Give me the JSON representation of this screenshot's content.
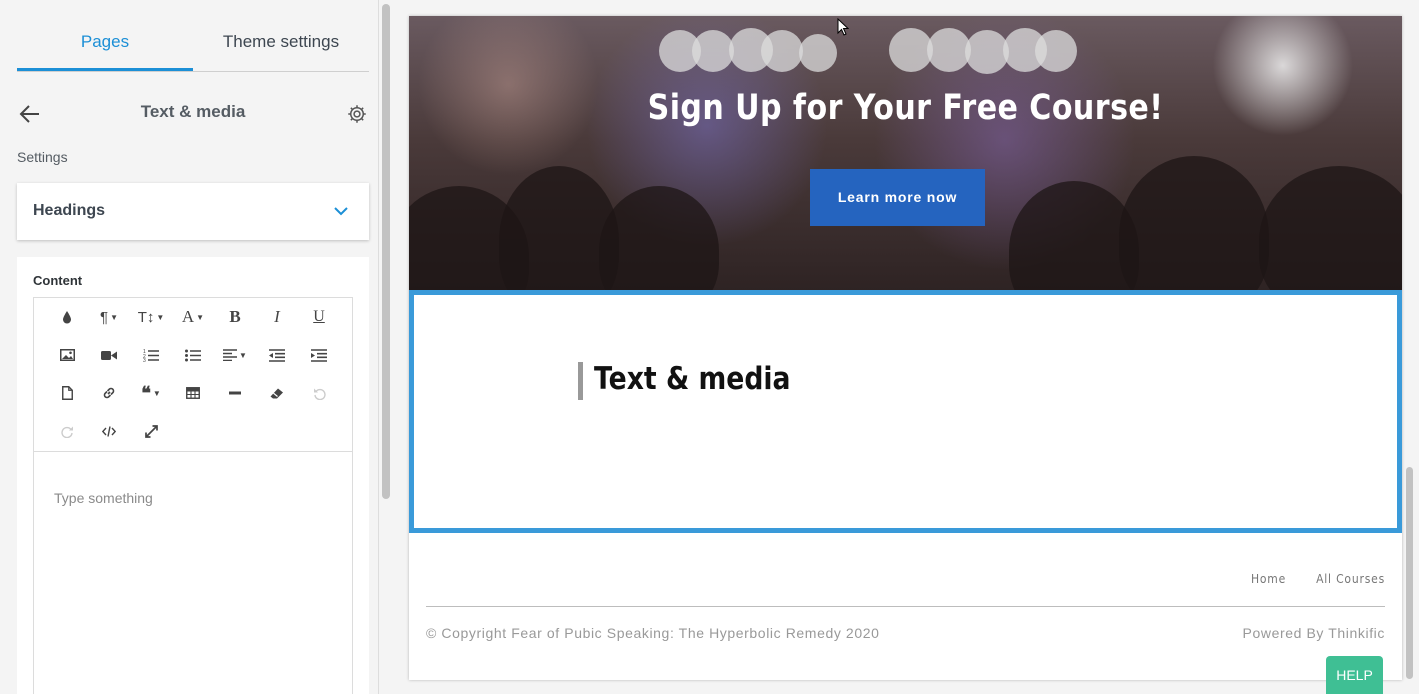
{
  "sidebar": {
    "tabs": [
      {
        "label": "Pages",
        "active": true
      },
      {
        "label": "Theme settings",
        "active": false
      }
    ],
    "section_title": "Text & media",
    "settings_label": "Settings",
    "headings_label": "Headings",
    "content_label": "Content",
    "editor_placeholder": "Type something",
    "toolbar_icons": [
      "color-icon",
      "paragraph-format-icon",
      "font-size-icon",
      "font-family-icon",
      "bold-icon",
      "italic-icon",
      "underline-icon",
      "insert-image-icon",
      "insert-video-icon",
      "ordered-list-icon",
      "unordered-list-icon",
      "align-icon",
      "outdent-icon",
      "indent-icon",
      "insert-file-icon",
      "insert-link-icon",
      "quote-icon",
      "insert-table-icon",
      "horizontal-line-icon",
      "clear-formatting-icon",
      "undo-icon",
      "redo-icon",
      "code-view-icon",
      "fullscreen-icon"
    ],
    "accent_color": "#1c8fd6"
  },
  "preview": {
    "banner": {
      "title": "Sign Up for Your Free Course!",
      "button_label": "Learn more now",
      "button_color": "#2564bf"
    },
    "text_media": {
      "heading": "Text & media",
      "selection_color": "#3a9ad9"
    },
    "footer": {
      "links": [
        "Home",
        "All Courses"
      ],
      "copyright": "© Copyright Fear of Pubic Speaking: The Hyperbolic Remedy 2020",
      "powered_by": "Powered By Thinkific"
    }
  },
  "help_label": "HELP",
  "help_color": "#3fbf94"
}
